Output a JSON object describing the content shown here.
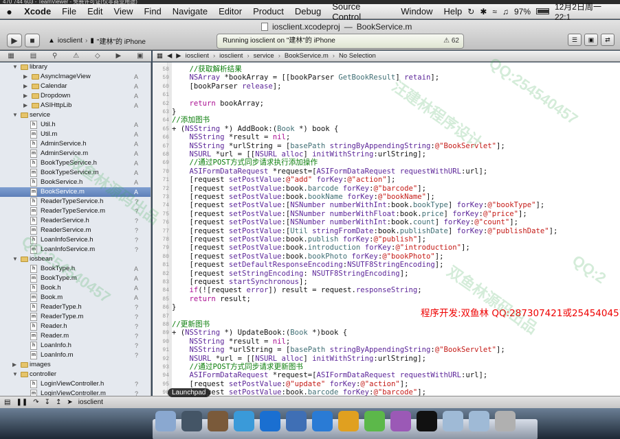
{
  "teamviewer_strip": "470 744 603 - TeamViewer - 免费许可证(仅非商业用途)",
  "menubar": {
    "app_name": "Xcode",
    "items": [
      "File",
      "Edit",
      "View",
      "Find",
      "Navigate",
      "Editor",
      "Product",
      "Debug",
      "Source Control",
      "Window",
      "Help"
    ],
    "battery": "97%",
    "clock": "12月2日周一 22:1"
  },
  "window_title": {
    "project": "iosclient.xcodeproj",
    "separator": "—",
    "file": "BookService.m"
  },
  "toolbar": {
    "run_icon": "play-icon",
    "stop_icon": "stop-icon",
    "scheme_target": "iosclient",
    "scheme_device": "\"建林\"的 iPhone",
    "activity_text": "Running iosclient on \"建林\"的 iPhone",
    "warning_count": "62"
  },
  "jump_bar": [
    "iosclient",
    "iosclient",
    "service",
    "BookService.m",
    "No Selection"
  ],
  "navigator": [
    {
      "indent": 1,
      "type": "folder",
      "name": "library",
      "open": true,
      "status": ""
    },
    {
      "indent": 2,
      "type": "folder",
      "name": "AsyncImageView",
      "open": false,
      "status": "A"
    },
    {
      "indent": 2,
      "type": "folder",
      "name": "Calendar",
      "open": false,
      "status": "A"
    },
    {
      "indent": 2,
      "type": "folder",
      "name": "Dropdown",
      "open": false,
      "status": "A"
    },
    {
      "indent": 2,
      "type": "folder",
      "name": "ASIHttpLib",
      "open": false,
      "status": "A"
    },
    {
      "indent": 1,
      "type": "folder",
      "name": "service",
      "open": true,
      "status": ""
    },
    {
      "indent": 2,
      "type": "h",
      "name": "Util.h",
      "status": "A"
    },
    {
      "indent": 2,
      "type": "m",
      "name": "Util.m",
      "status": "A"
    },
    {
      "indent": 2,
      "type": "h",
      "name": "AdminService.h",
      "status": "A"
    },
    {
      "indent": 2,
      "type": "m",
      "name": "AdminService.m",
      "status": "A"
    },
    {
      "indent": 2,
      "type": "h",
      "name": "BookTypeService.h",
      "status": "A"
    },
    {
      "indent": 2,
      "type": "m",
      "name": "BookTypeService.m",
      "status": "A"
    },
    {
      "indent": 2,
      "type": "h",
      "name": "BookService.h",
      "status": "A"
    },
    {
      "indent": 2,
      "type": "m",
      "name": "BookService.m",
      "status": "A",
      "selected": true
    },
    {
      "indent": 2,
      "type": "h",
      "name": "ReaderTypeService.h",
      "status": "?"
    },
    {
      "indent": 2,
      "type": "m",
      "name": "ReaderTypeService.m",
      "status": "?"
    },
    {
      "indent": 2,
      "type": "h",
      "name": "ReaderService.h",
      "status": "?"
    },
    {
      "indent": 2,
      "type": "m",
      "name": "ReaderService.m",
      "status": "?"
    },
    {
      "indent": 2,
      "type": "h",
      "name": "LoanInfoService.h",
      "status": "?"
    },
    {
      "indent": 2,
      "type": "m",
      "name": "LoanInfoService.m",
      "status": "?"
    },
    {
      "indent": 1,
      "type": "folder",
      "name": "iosbean",
      "open": true,
      "status": ""
    },
    {
      "indent": 2,
      "type": "h",
      "name": "BookType.h",
      "status": "A"
    },
    {
      "indent": 2,
      "type": "m",
      "name": "BookType.m",
      "status": "A"
    },
    {
      "indent": 2,
      "type": "h",
      "name": "Book.h",
      "status": "A"
    },
    {
      "indent": 2,
      "type": "m",
      "name": "Book.m",
      "status": "A"
    },
    {
      "indent": 2,
      "type": "h",
      "name": "ReaderType.h",
      "status": "?"
    },
    {
      "indent": 2,
      "type": "m",
      "name": "ReaderType.m",
      "status": "?"
    },
    {
      "indent": 2,
      "type": "h",
      "name": "Reader.h",
      "status": "?"
    },
    {
      "indent": 2,
      "type": "m",
      "name": "Reader.m",
      "status": "?"
    },
    {
      "indent": 2,
      "type": "h",
      "name": "LoanInfo.h",
      "status": "?"
    },
    {
      "indent": 2,
      "type": "m",
      "name": "LoanInfo.m",
      "status": "?"
    },
    {
      "indent": 1,
      "type": "folder",
      "name": "images",
      "open": false,
      "status": ""
    },
    {
      "indent": 1,
      "type": "folder",
      "name": "controller",
      "open": true,
      "status": ""
    },
    {
      "indent": 2,
      "type": "h",
      "name": "LoginViewController.h",
      "status": "?"
    },
    {
      "indent": 2,
      "type": "m",
      "name": "LoginViewController.m",
      "status": "?"
    }
  ],
  "code_lines": [
    {
      "n": "58",
      "html": "<span class='c'>    //获取解析结果</span>"
    },
    {
      "n": "59",
      "html": "    <span class='t'>NSArray</span> *bookArray = [[bookParser <span class='p'>GetBookResult</span>] <span class='t'>retain</span>];"
    },
    {
      "n": "60",
      "html": "    [bookParser <span class='t'>release</span>];"
    },
    {
      "n": "61",
      "html": ""
    },
    {
      "n": "62",
      "html": "    <span class='k'>return</span> bookArray;"
    },
    {
      "n": "63",
      "html": "}"
    },
    {
      "n": "64",
      "html": "<span class='c'>//添加图书</span>"
    },
    {
      "n": "65",
      "html": "+ (<span class='t'>NSString</span> *) AddBook:(<span class='p'>Book</span> *) book {"
    },
    {
      "n": "66",
      "html": "    <span class='t'>NSString</span> *result = <span class='k'>nil</span>;"
    },
    {
      "n": "67",
      "html": "    <span class='t'>NSString</span> *urlString = [<span class='p'>basePath</span> <span class='t'>stringByAppendingString</span>:<span class='s'>@\"BookServlet\"</span>];"
    },
    {
      "n": "68",
      "html": "    <span class='t'>NSURL</span> *url = [[<span class='t'>NSURL</span> <span class='t'>alloc</span>] <span class='t'>initWithString</span>:urlString];"
    },
    {
      "n": "69",
      "html": "<span class='c'>    //通过POST方式同步请求执行添加操作</span>"
    },
    {
      "n": "70",
      "html": "    <span class='t'>ASIFormDataRequest</span> *request=[<span class='t'>ASIFormDataRequest</span> <span class='t'>requestWithURL</span>:url];"
    },
    {
      "n": "71",
      "html": "    [request <span class='t'>setPostValue</span>:<span class='s'>@\"add\"</span> <span class='t'>forKey</span>:<span class='s'>@\"action\"</span>];"
    },
    {
      "n": "72",
      "html": "    [request <span class='t'>setPostValue</span>:book.<span class='p'>barcode</span> <span class='t'>forKey</span>:<span class='s'>@\"barcode\"</span>];"
    },
    {
      "n": "73",
      "html": "    [request <span class='t'>setPostValue</span>:book.<span class='p'>bookName</span> <span class='t'>forKey</span>:<span class='s'>@\"bookName\"</span>];"
    },
    {
      "n": "74",
      "html": "    [request <span class='t'>setPostValue</span>:[<span class='t'>NSNumber</span> <span class='t'>numberWithInt</span>:book.<span class='p'>bookType</span>] <span class='t'>forKey</span>:<span class='s'>@\"bookType\"</span>];"
    },
    {
      "n": "75",
      "html": "    [request <span class='t'>setPostValue</span>:[<span class='t'>NSNumber</span> <span class='t'>numberWithFloat</span>:book.<span class='p'>price</span>] <span class='t'>forKey</span>:<span class='s'>@\"price\"</span>];"
    },
    {
      "n": "76",
      "html": "    [request <span class='t'>setPostValue</span>:[<span class='t'>NSNumber</span> <span class='t'>numberWithInt</span>:book.<span class='p'>count</span>] <span class='t'>forKey</span>:<span class='s'>@\"count\"</span>];"
    },
    {
      "n": "77",
      "html": "    [request <span class='t'>setPostValue</span>:[<span class='p'>Util</span> <span class='t'>stringFromDate</span>:book.<span class='p'>publishDate</span>] <span class='t'>forKey</span>:<span class='s'>@\"publishDate\"</span>];"
    },
    {
      "n": "78",
      "html": "    [request <span class='t'>setPostValue</span>:book.<span class='p'>publish</span> <span class='t'>forKey</span>:<span class='s'>@\"publish\"</span>];"
    },
    {
      "n": "79",
      "html": "    [request <span class='t'>setPostValue</span>:book.<span class='p'>introduction</span> <span class='t'>forKey</span>:<span class='s'>@\"introduction\"</span>];"
    },
    {
      "n": "80",
      "html": "    [request <span class='t'>setPostValue</span>:book.<span class='p'>bookPhoto</span> <span class='t'>forKey</span>:<span class='s'>@\"bookPhoto\"</span>];"
    },
    {
      "n": "81",
      "html": "    [request <span class='t'>setDefaultResponseEncoding</span>:<span class='t'>NSUTF8StringEncoding</span>];"
    },
    {
      "n": "82",
      "html": "    [request <span class='t'>setStringEncoding</span>: <span class='t'>NSUTF8StringEncoding</span>];"
    },
    {
      "n": "83",
      "html": "    [request <span class='t'>startSynchronous</span>];"
    },
    {
      "n": "84",
      "html": "    <span class='k'>if</span>(![request <span class='t'>error</span>]) result = request.<span class='t'>responseString</span>;"
    },
    {
      "n": "85",
      "html": "    <span class='k'>return</span> result;"
    },
    {
      "n": "86",
      "html": "}"
    },
    {
      "n": "87",
      "html": ""
    },
    {
      "n": "88",
      "html": "<span class='c'>//更新图书</span>"
    },
    {
      "n": "89",
      "html": "+ (<span class='t'>NSString</span> *) UpdateBook:(<span class='p'>Book</span> *)book {"
    },
    {
      "n": "90",
      "html": "    <span class='t'>NSString</span> *result = <span class='k'>nil</span>;"
    },
    {
      "n": "91",
      "html": "    <span class='t'>NSString</span> *urlString = [<span class='p'>basePath</span> <span class='t'>stringByAppendingString</span>:<span class='s'>@\"BookServlet\"</span>];"
    },
    {
      "n": "92",
      "html": "    <span class='t'>NSURL</span> *url = [[<span class='t'>NSURL</span> <span class='t'>alloc</span>] <span class='t'>initWithString</span>:urlString];"
    },
    {
      "n": "93",
      "html": "<span class='c'>    //通过POST方式同步请求更新图书</span>"
    },
    {
      "n": "94",
      "html": "    <span class='t'>ASIFormDataRequest</span> *request=[<span class='t'>ASIFormDataRequest</span> <span class='t'>requestWithURL</span>:url];"
    },
    {
      "n": "95",
      "html": "    [request <span class='t'>setPostValue</span>:<span class='s'>@\"update\"</span> <span class='t'>forKey</span>:<span class='s'>@\"action\"</span>];"
    },
    {
      "n": "96",
      "html": "    [request <span class='t'>setPostValue</span>:book.<span class='p'>barcode</span> <span class='t'>forKey</span>:<span class='s'>@\"barcode\"</span>];"
    }
  ],
  "overlay_text": "程序开发:双鱼林 QQ:287307421或254540457 www.shuangyulin.com",
  "bottom_bar": {
    "target": "iosclient"
  },
  "launchpad_tooltip": "Launchpad",
  "watermarks": [
    "QQ:254540457",
    "双鱼林源码出品",
    "汪建林程序设计",
    "QQ:254540457",
    "双鱼林源码出品",
    "QQ:2"
  ],
  "dock_icons": [
    "finder-icon",
    "rocket-icon",
    "photo-icon",
    "messages-icon",
    "teamviewer-icon",
    "xcode-icon",
    "safari-icon",
    "sync-icon",
    "add-icon",
    "bike-icon",
    "qq-icon",
    "folder-icon",
    "folder-icon",
    "trash-icon"
  ],
  "colors": {
    "selection": "#6a8cc4",
    "comment": "#0a7d0a",
    "string": "#c41a16",
    "keyword": "#aa0d91"
  }
}
